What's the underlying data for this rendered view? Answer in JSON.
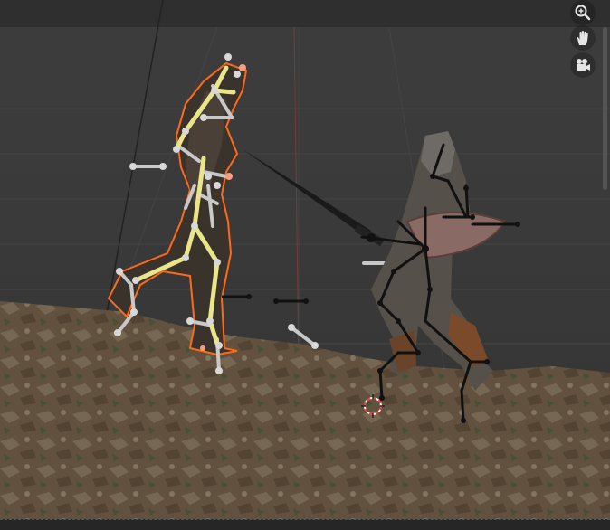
{
  "viewport": {
    "background": "#3a3a3a",
    "gizmo": [
      {
        "name": "zoom",
        "icon": "magnifier-icon"
      },
      {
        "name": "pan",
        "icon": "hand-icon"
      },
      {
        "name": "camera",
        "icon": "camera-icon"
      }
    ],
    "colors": {
      "selection_outline": "#ff6a1a",
      "active_bone": "#e8e58a",
      "pose_bone": "#c8c8c8",
      "unselected_bone": "#111111",
      "terrain": "#6b5a45",
      "cursor_ring": "#ff4040"
    }
  },
  "objects": [
    {
      "name": "selected-knight-armature",
      "state": "selected"
    },
    {
      "name": "knight-with-shield",
      "state": "unselected"
    }
  ]
}
